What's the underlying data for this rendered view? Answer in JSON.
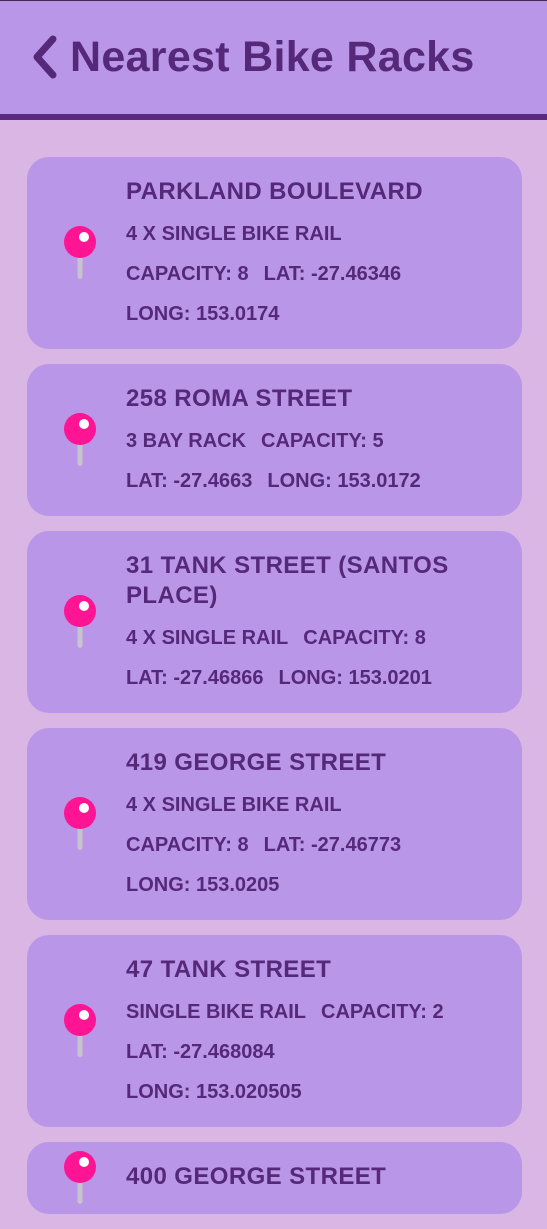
{
  "header": {
    "title": "Nearest Bike Racks",
    "back_icon": "chevron-left-icon"
  },
  "colors": {
    "background": "#d9b6e3",
    "card": "#ba96e8",
    "text": "#55287a",
    "pin": "#ff1493"
  },
  "racks": [
    {
      "name": "PARKLAND BOULEVARD",
      "lines": [
        [
          "4 X SINGLE BIKE RAIL"
        ],
        [
          "CAPACITY: 8",
          "LAT: -27.46346"
        ],
        [
          "LONG: 153.0174"
        ]
      ]
    },
    {
      "name": "258 ROMA STREET",
      "lines": [
        [
          "3 BAY RACK",
          "CAPACITY: 5"
        ],
        [
          "LAT: -27.4663",
          "LONG: 153.0172"
        ]
      ]
    },
    {
      "name": "31 TANK STREET (SANTOS PLACE)",
      "lines": [
        [
          "4 X SINGLE RAIL",
          "CAPACITY: 8"
        ],
        [
          "LAT: -27.46866",
          "LONG: 153.0201"
        ]
      ]
    },
    {
      "name": "419 GEORGE STREET",
      "lines": [
        [
          "4 X SINGLE BIKE RAIL"
        ],
        [
          "CAPACITY: 8",
          "LAT: -27.46773"
        ],
        [
          "LONG: 153.0205"
        ]
      ]
    },
    {
      "name": "47 TANK STREET",
      "lines": [
        [
          "SINGLE BIKE RAIL",
          "CAPACITY: 2"
        ],
        [
          "LAT: -27.468084"
        ],
        [
          "LONG: 153.020505"
        ]
      ]
    },
    {
      "name": "400 GEORGE STREET",
      "lines": []
    }
  ]
}
